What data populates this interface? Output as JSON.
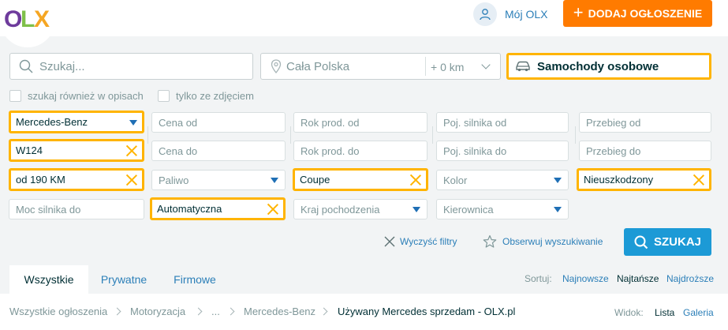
{
  "header": {
    "logo_letters": [
      "O",
      "L",
      "X"
    ],
    "moj_olx": "Mój OLX",
    "dodaj_label": "DODAJ OGŁOSZENIE"
  },
  "search": {
    "query_placeholder": "Szukaj...",
    "location_placeholder": "Cała Polska",
    "distance": "+ 0 km",
    "category": "Samochody osobowe",
    "checkbox_opisach": "szukaj również w opisach",
    "checkbox_zdjeciem": "tylko ze zdjęciem"
  },
  "filters": {
    "marka": "Mercedes-Benz",
    "model": "W124",
    "moc_od": "od 190 KM",
    "moc_do_placeholder": "Moc silnika do",
    "cena_od": "Cena od",
    "cena_do": "Cena do",
    "paliwo": "Paliwo",
    "skrzynia": "Automatyczna",
    "rok_od": "Rok prod. od",
    "rok_do": "Rok prod. do",
    "nadwozie": "Coupe",
    "kraj": "Kraj pochodzenia",
    "poj_od": "Poj. silnika od",
    "poj_do": "Poj. silnika do",
    "kolor": "Kolor",
    "kierownica": "Kierownica",
    "przebieg_od": "Przebieg od",
    "przebieg_do": "Przebieg do",
    "stan": "Nieuszkodzony"
  },
  "actions": {
    "clear": "Wyczyść filtry",
    "observe": "Obserwuj wyszukiwanie",
    "search": "SZUKAJ"
  },
  "tabs": {
    "all": "Wszystkie",
    "private": "Prywatne",
    "business": "Firmowe"
  },
  "sort": {
    "label": "Sortuj:",
    "newest": "Najnowsze",
    "cheapest": "Najtańsze",
    "priciest": "Najdroższe"
  },
  "breadcrumb": {
    "items": [
      "Wszystkie ogłoszenia",
      "Motoryzacja",
      "...",
      "Mercedes-Benz",
      "Używany Mercedes sprzedam - OLX.pl"
    ]
  },
  "view": {
    "label": "Widok:",
    "list": "Lista",
    "gallery": "Galeria"
  },
  "colors": {
    "accent_orange": "#ff7b00",
    "selected_border": "#ffb400",
    "link_blue": "#2c7fb8",
    "search_button": "#1c9ad6"
  }
}
